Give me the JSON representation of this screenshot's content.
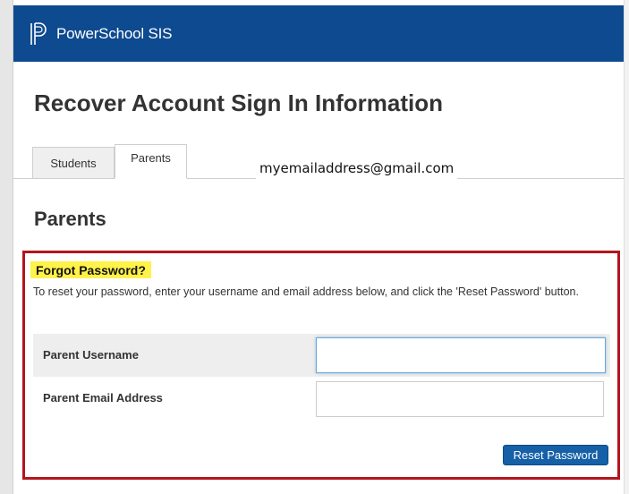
{
  "header": {
    "app_title": "PowerSchool SIS",
    "logo_icon": "powerschool-logo-icon",
    "background": "#0e4a8f"
  },
  "page": {
    "title": "Recover Account Sign In Information"
  },
  "tabs": [
    {
      "label": "Students",
      "active": false
    },
    {
      "label": "Parents",
      "active": true
    }
  ],
  "annotation": {
    "email_text": "myemailaddress@gmail.com",
    "highlight_color": "#b3151d"
  },
  "section": {
    "title": "Parents"
  },
  "form": {
    "heading": "Forgot Password?",
    "heading_highlight": "#fff24a",
    "instructions": "To reset your password, enter your username and email address below, and click the 'Reset Password' button.",
    "username_label": "Parent Username",
    "username_value": "",
    "email_label": "Parent Email Address",
    "email_value": "",
    "reset_button_label": "Reset Password",
    "accent": "#1560a6"
  }
}
